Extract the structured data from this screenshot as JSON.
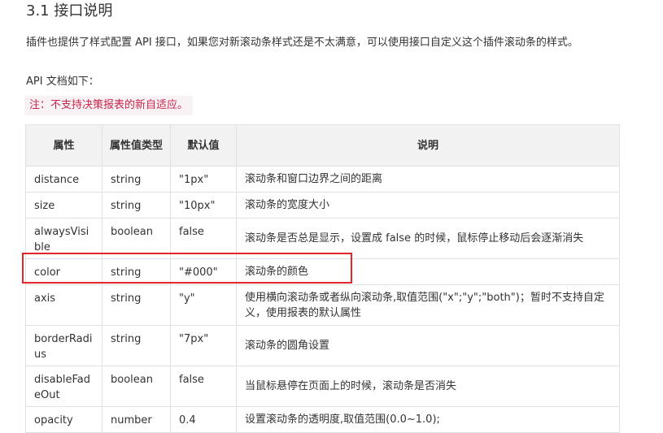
{
  "heading": "3.1 接口说明",
  "intro": "插件也提供了样式配置 API 接口，如果您对新滚动条样式还是不太满意，可以使用接口自定义这个插件滚动条的样式。",
  "api_doc_label": "API 文档如下：",
  "note": "注：不支持决策报表的新自适应。",
  "table": {
    "headers": [
      "属性",
      "属性值类型",
      "默认值",
      "说明"
    ],
    "rows": [
      {
        "key": "distance",
        "type": "string",
        "default": "\"1px\"",
        "desc": "滚动条和窗口边界之间的距离"
      },
      {
        "key": "size",
        "type": "string",
        "default": "\"10px\"",
        "desc": "滚动条的宽度大小"
      },
      {
        "key": "alwaysVisible",
        "type": "boolean",
        "default": "false",
        "desc": "滚动条是否总是显示，设置成 false 的时候，鼠标停止移动后会逐渐消失"
      },
      {
        "key": "color",
        "type": "string",
        "default": "\"#000\"",
        "desc": "滚动条的颜色"
      },
      {
        "key": "axis",
        "type": "string",
        "default": "\"y\"",
        "desc": "使用横向滚动条或者纵向滚动条,取值范围(\"x\";\"y\";\"both\")；暂时不支持自定义，使用报表的默认属性"
      },
      {
        "key": "borderRadius",
        "type": "string",
        "default": "\"7px\"",
        "desc": "滚动条的圆角设置"
      },
      {
        "key": "disableFadeOut",
        "type": "boolean",
        "default": "false",
        "desc": "当鼠标悬停在页面上的时候，滚动条是否消失"
      },
      {
        "key": "opacity",
        "type": "number",
        "default": "0.4",
        "desc": "设置滚动条的透明度,取值范围(0.0~1.0);"
      }
    ]
  },
  "highlight_color": "#e5252a",
  "note_color": "#c7254e"
}
